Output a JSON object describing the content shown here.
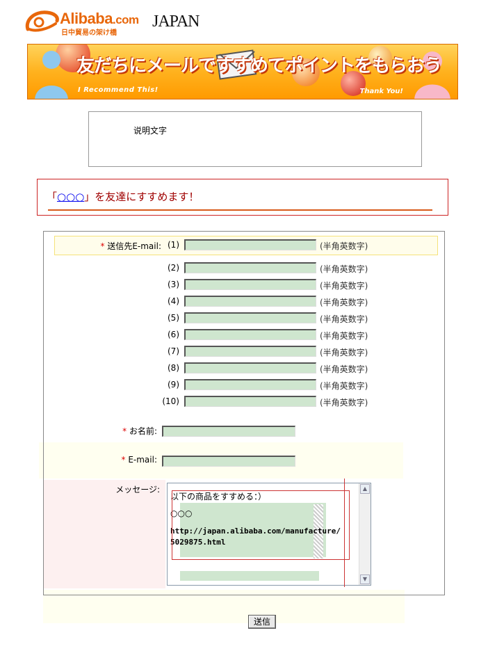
{
  "logo": {
    "brand": "Alibaba",
    "brand_suffix": ".com",
    "subtitle": "日中貿易の架け橋",
    "region": "JAPAN"
  },
  "banner": {
    "title": "友だちにメールですすめてポイントをもらおう",
    "left_tag": "I Recommend This!",
    "right_tag": "Thank You!"
  },
  "description": {
    "text": "说明文字"
  },
  "recommend": {
    "prefix": "「",
    "link": "○○○",
    "suffix": "」を友達にすすめます！"
  },
  "form": {
    "recipient_label": "送信先E-mail:",
    "required_mark": "*",
    "recipients": [
      {
        "num": "(1)",
        "value": "",
        "hint": "(半角英数字)"
      },
      {
        "num": "(2)",
        "value": "",
        "hint": "(半角英数字)"
      },
      {
        "num": "(3)",
        "value": "",
        "hint": "(半角英数字)"
      },
      {
        "num": "(4)",
        "value": "",
        "hint": "(半角英数字)"
      },
      {
        "num": "(5)",
        "value": "",
        "hint": "(半角英数字)"
      },
      {
        "num": "(6)",
        "value": "",
        "hint": "(半角英数字)"
      },
      {
        "num": "(7)",
        "value": "",
        "hint": "(半角英数字)"
      },
      {
        "num": "(8)",
        "value": "",
        "hint": "(半角英数字)"
      },
      {
        "num": "(9)",
        "value": "",
        "hint": "(半角英数字)"
      },
      {
        "num": "(10)",
        "value": "",
        "hint": "(半角英数字)"
      }
    ],
    "name_label": "お名前:",
    "name_value": "",
    "email_label": "E-mail:",
    "email_value": "",
    "message_label": "メッセージ:",
    "message_lines": [
      "以下の商品をすすめる：）",
      "○○○",
      "http://japan.alibaba.com/manufacture/",
      "5029875.html"
    ],
    "submit_label": "送信"
  },
  "colors": {
    "field_bg": "#cfe6cf",
    "accent_orange": "#e8670b",
    "heading_red": "#a00000"
  }
}
